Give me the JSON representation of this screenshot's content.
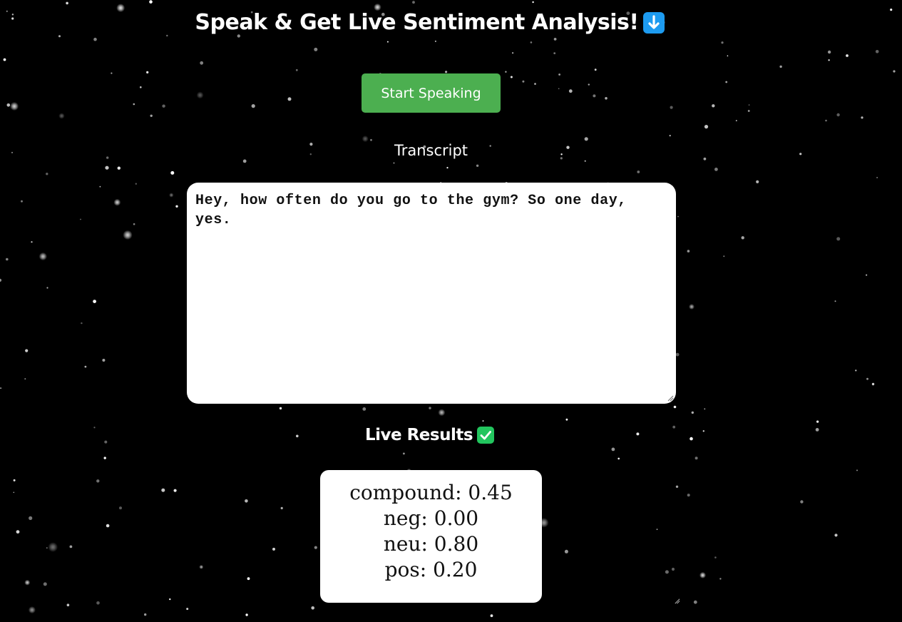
{
  "header": {
    "title": "Speak & Get Live Sentiment Analysis!",
    "title_emoji": "down-arrow-icon"
  },
  "controls": {
    "start_label": "Start Speaking",
    "start_color": "#4caf50"
  },
  "transcript": {
    "label": "Transcript",
    "text": "Hey, how often do you go to the gym? So one day, yes."
  },
  "results": {
    "title": "Live Results",
    "title_emoji": "check-mark-icon",
    "items": [
      {
        "label": "compound",
        "text": "compound: 0.45"
      },
      {
        "label": "neg",
        "text": "neg: 0.00"
      },
      {
        "label": "neu",
        "text": "neu: 0.80"
      },
      {
        "label": "pos",
        "text": "pos: 0.20"
      }
    ]
  },
  "theme": {
    "background": "#000000",
    "panel": "#ffffff",
    "emoji_blue": "#1d9bf0",
    "emoji_green": "#22c55e"
  }
}
